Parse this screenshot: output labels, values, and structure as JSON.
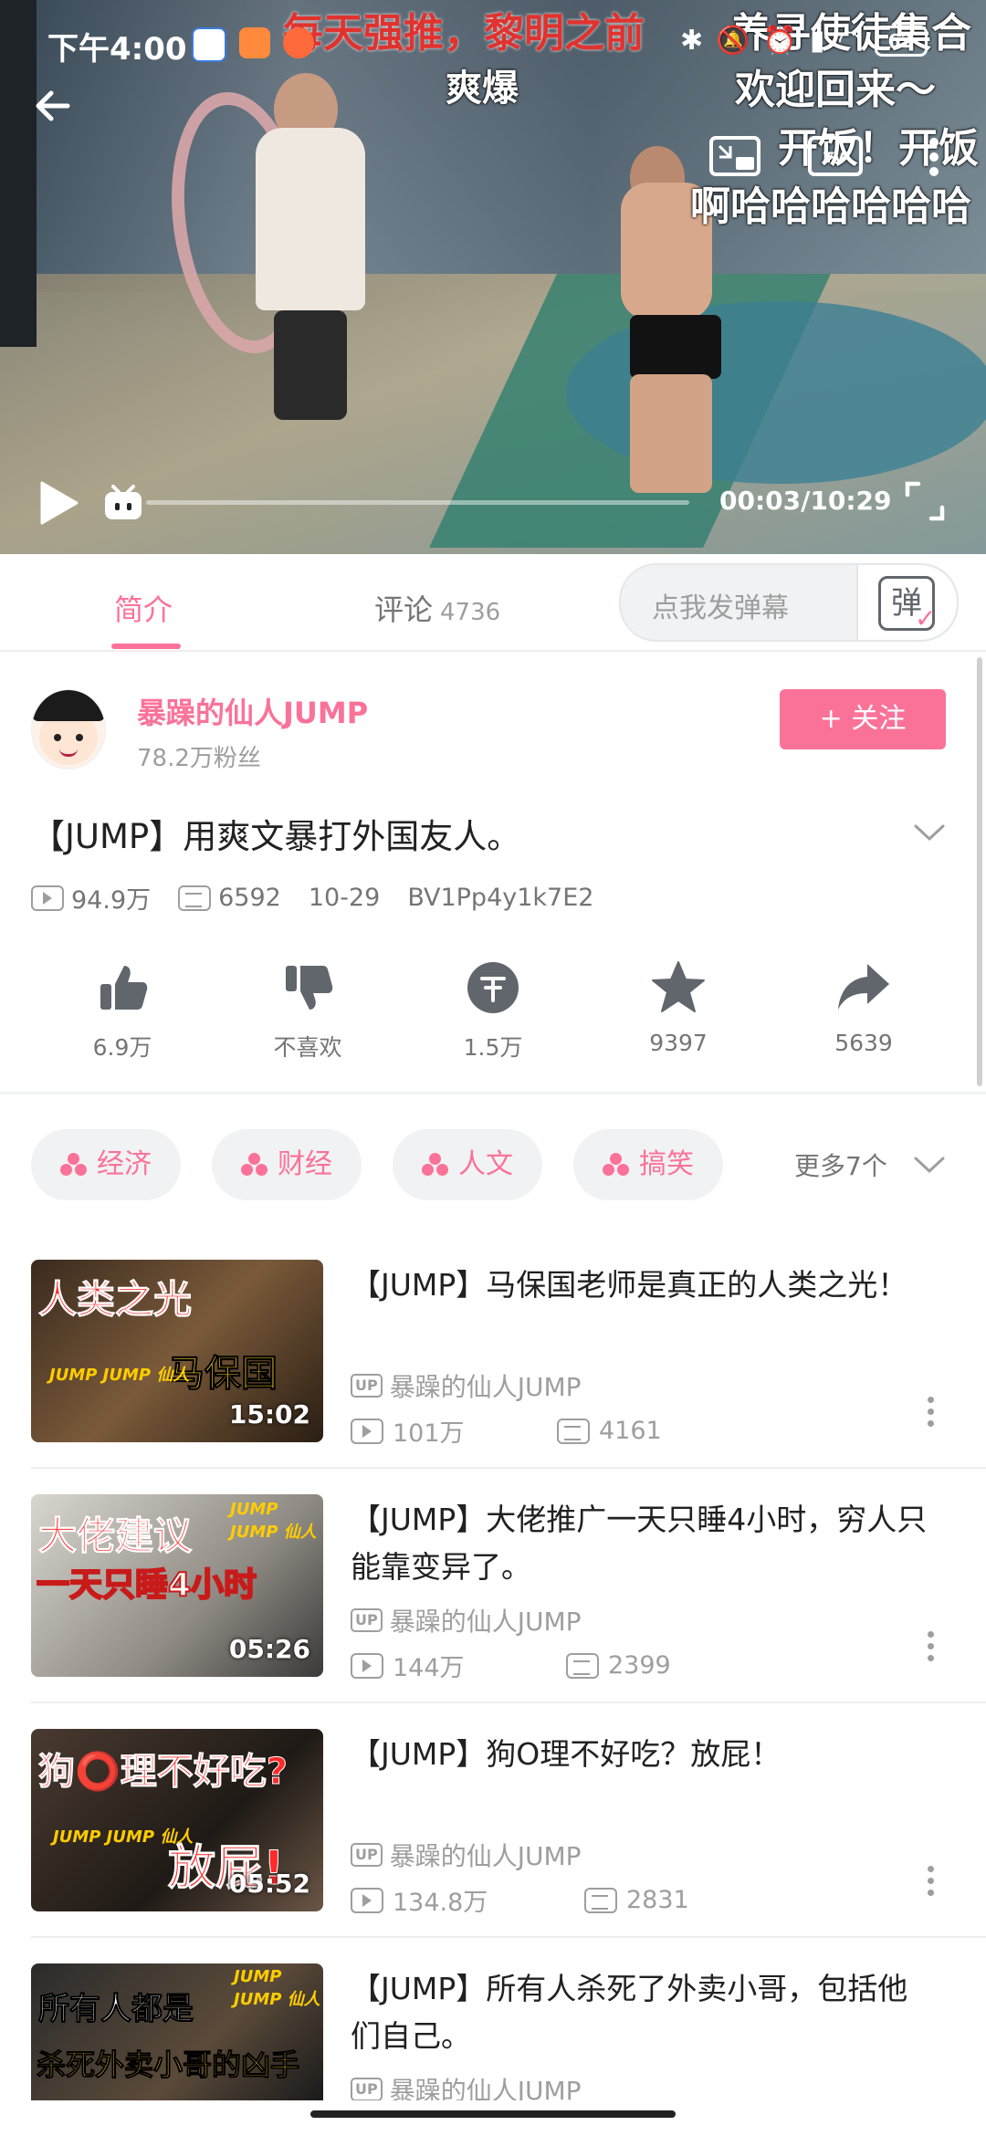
{
  "status_bar": {
    "time": "下午4:00",
    "battery": "62"
  },
  "video": {
    "danmaku": [
      "每天强推，黎明之前",
      "爽爆",
      "养寻使徒集合",
      "欢迎回来～",
      "开饭！开饭",
      "啊哈哈哈哈哈哈"
    ],
    "time_display": "00:03/10:29"
  },
  "tabs": {
    "intro": "简介",
    "comments": "评论",
    "comments_count": "4736",
    "danmaku_placeholder": "点我发弹幕",
    "danmaku_toggle_glyph": "弹"
  },
  "uploader": {
    "name": "暴躁的仙人JUMP",
    "fans": "78.2万粉丝",
    "follow_label": "+ 关注"
  },
  "video_info": {
    "title": "【JUMP】用爽文暴打外国友人。",
    "views": "94.9万",
    "danmaku_count": "6592",
    "date": "10-29",
    "bvid": "BV1Pp4y1k7E2"
  },
  "actions": {
    "like": "6.9万",
    "dislike": "不喜欢",
    "coin": "1.5万",
    "favorite": "9397",
    "share": "5639"
  },
  "tags": [
    "经济",
    "财经",
    "人文",
    "搞笑"
  ],
  "more_tags": "更多7个",
  "related": [
    {
      "title": "【JUMP】马保国老师是真正的人类之光！",
      "up": "暴躁的仙人JUMP",
      "views": "101万",
      "danmaku": "4161",
      "duration": "15:02",
      "thumb_line1": "人类之光",
      "thumb_line2": "马保国"
    },
    {
      "title": "【JUMP】大佬推广一天只睡4小时，穷人只能靠变异了。",
      "up": "暴躁的仙人JUMP",
      "views": "144万",
      "danmaku": "2399",
      "duration": "05:26",
      "thumb_line1": "大佬建议",
      "thumb_line2": "一天只睡4小时"
    },
    {
      "title": "【JUMP】狗O理不好吃？放屁！",
      "up": "暴躁的仙人JUMP",
      "views": "134.8万",
      "danmaku": "2831",
      "duration": "05:52",
      "thumb_line1": "狗⭕理不好吃?",
      "thumb_line2": "放屁!"
    },
    {
      "title": "【JUMP】所有人杀死了外卖小哥，包括他们自己。",
      "up": "暴躁的仙人JUMP",
      "views": "",
      "danmaku": "",
      "duration": "",
      "thumb_line1": "所有人都是",
      "thumb_line2": "杀死外卖小哥的凶手"
    }
  ],
  "thumb_logo": "JUMP JUMP 仙人",
  "up_badge": "UP",
  "colors": {
    "accent": "#fb7299",
    "text_primary": "#212121",
    "text_secondary": "#9e9e9e"
  }
}
